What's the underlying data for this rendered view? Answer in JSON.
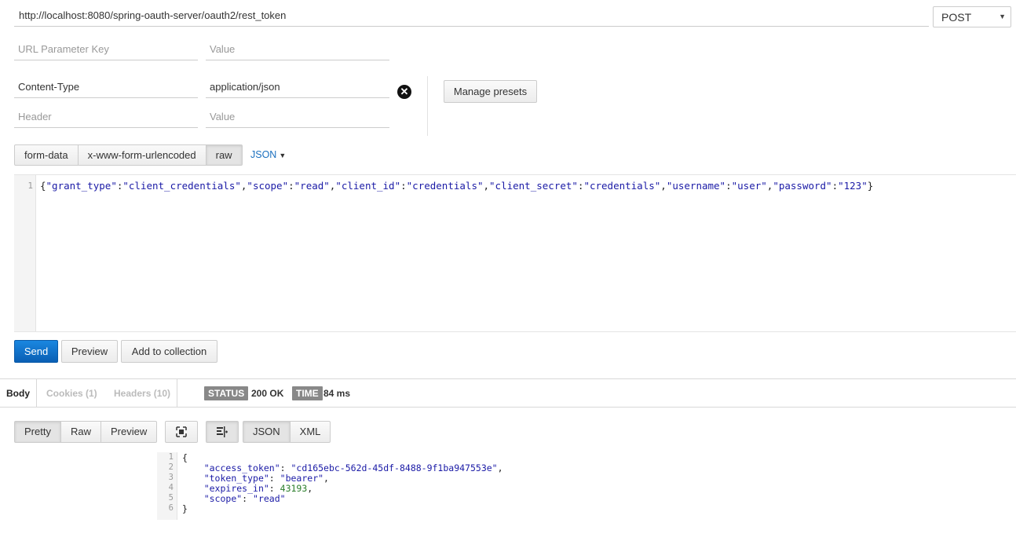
{
  "request": {
    "url": "http://localhost:8080/spring-oauth-server/oauth2/rest_token",
    "method": "POST",
    "url_param_key_placeholder": "URL Parameter Key",
    "url_param_value_placeholder": "Value",
    "headers": [
      {
        "key": "Content-Type",
        "value": "application/json"
      }
    ],
    "header_key_placeholder": "Header",
    "header_value_placeholder": "Value",
    "manage_presets_label": "Manage presets",
    "body_modes": [
      "form-data",
      "x-www-form-urlencoded",
      "raw"
    ],
    "active_body_mode": "raw",
    "raw_type": "JSON",
    "body_line_number": "1",
    "body_raw": "{\"grant_type\":\"client_credentials\",\"scope\":\"read\",\"client_id\":\"credentials\",\"client_secret\":\"credentials\",\"username\":\"user\",\"password\":\"123\"}"
  },
  "actions": {
    "send_label": "Send",
    "preview_label": "Preview",
    "add_to_collection_label": "Add to collection"
  },
  "response": {
    "tabs": [
      "Body",
      "Cookies (1)",
      "Headers (10)"
    ],
    "status_label": "STATUS",
    "status_value": "200 OK",
    "time_label": "TIME",
    "time_value": "84 ms",
    "view_modes": [
      "Pretty",
      "Raw",
      "Preview"
    ],
    "active_view_mode": "Pretty",
    "formats": [
      "JSON",
      "XML"
    ],
    "active_format": "JSON",
    "line_numbers": [
      "1",
      "2",
      "3",
      "4",
      "5",
      "6"
    ],
    "body": {
      "access_token": "cd165ebc-562d-45df-8488-9f1ba947553e",
      "token_type": "bearer",
      "expires_in": 43193,
      "scope": "read"
    }
  },
  "colors": {
    "send_button": "#0a6fd0",
    "json_string": "#1a1aa6",
    "json_number": "#2a7d2a",
    "badge_bg": "#888888"
  },
  "icons": [
    "remove-icon",
    "caret-down-icon",
    "fullscreen-icon",
    "wrap-icon"
  ]
}
